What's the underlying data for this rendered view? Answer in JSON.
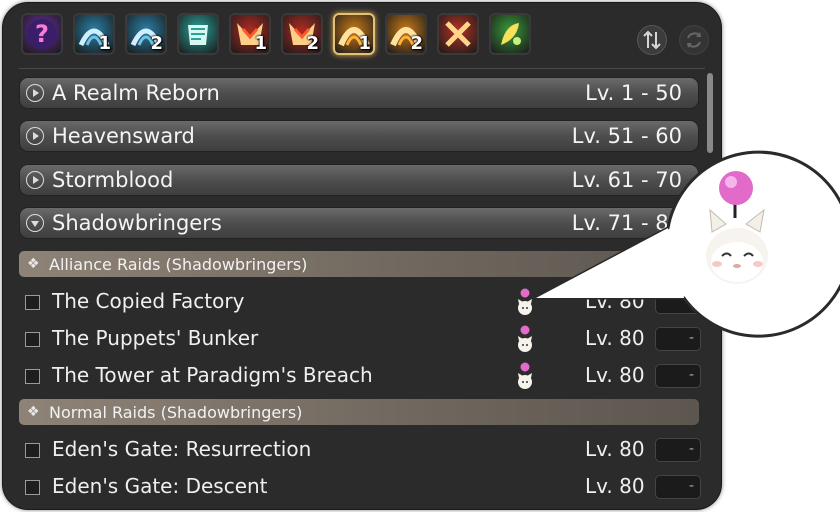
{
  "toolbar": {
    "tabs": [
      {
        "icon": "question-icon",
        "number": "",
        "color": "#6a2fa0"
      },
      {
        "icon": "dungeon-icon",
        "number": "1",
        "color": "#2a7fa6"
      },
      {
        "icon": "dungeon-icon",
        "number": "2",
        "color": "#2a7fa6"
      },
      {
        "icon": "guildhest-icon",
        "number": "",
        "color": "#2aa39a"
      },
      {
        "icon": "trial-icon",
        "number": "1",
        "color": "#b02b22"
      },
      {
        "icon": "trial-icon",
        "number": "2",
        "color": "#b02b22"
      },
      {
        "icon": "raid-icon",
        "number": "1",
        "color": "#c97a18"
      },
      {
        "icon": "raid-icon",
        "number": "2",
        "color": "#c97a18"
      },
      {
        "icon": "pvp-icon",
        "number": "",
        "color": "#b33323"
      },
      {
        "icon": "gold-saucer-icon",
        "number": "",
        "color": "#3a9a3a"
      }
    ],
    "active_tab": 6,
    "sort_icon": "sort-icon",
    "refresh_icon": "refresh-icon"
  },
  "categories": [
    {
      "name": "A Realm Reborn",
      "level": "Lv.  1 - 50",
      "expanded": false
    },
    {
      "name": "Heavensward",
      "level": "Lv. 51 - 60",
      "expanded": false
    },
    {
      "name": "Stormblood",
      "level": "Lv. 61 - 70",
      "expanded": false
    },
    {
      "name": "Shadowbringers",
      "level": "Lv. 71 - 80",
      "expanded": true
    }
  ],
  "subcategories": [
    {
      "name": "Alliance Raids (Shadowbringers)"
    },
    {
      "name": "Normal Raids (Shadowbringers)"
    }
  ],
  "duties": [
    {
      "name": "The Copied Factory",
      "level": "Lv. 80",
      "slot": "-",
      "moogle": true
    },
    {
      "name": "The Puppets' Bunker",
      "level": "Lv. 80",
      "slot": "-",
      "moogle": true
    },
    {
      "name": "The Tower at Paradigm's Breach",
      "level": "Lv. 80",
      "slot": "-",
      "moogle": true
    },
    {
      "name": "Eden's Gate: Resurrection",
      "level": "Lv. 80",
      "slot": "-",
      "moogle": false
    },
    {
      "name": "Eden's Gate: Descent",
      "level": "Lv. 80",
      "slot": "-",
      "moogle": false
    }
  ],
  "callout": {
    "icon": "moogle-icon"
  }
}
